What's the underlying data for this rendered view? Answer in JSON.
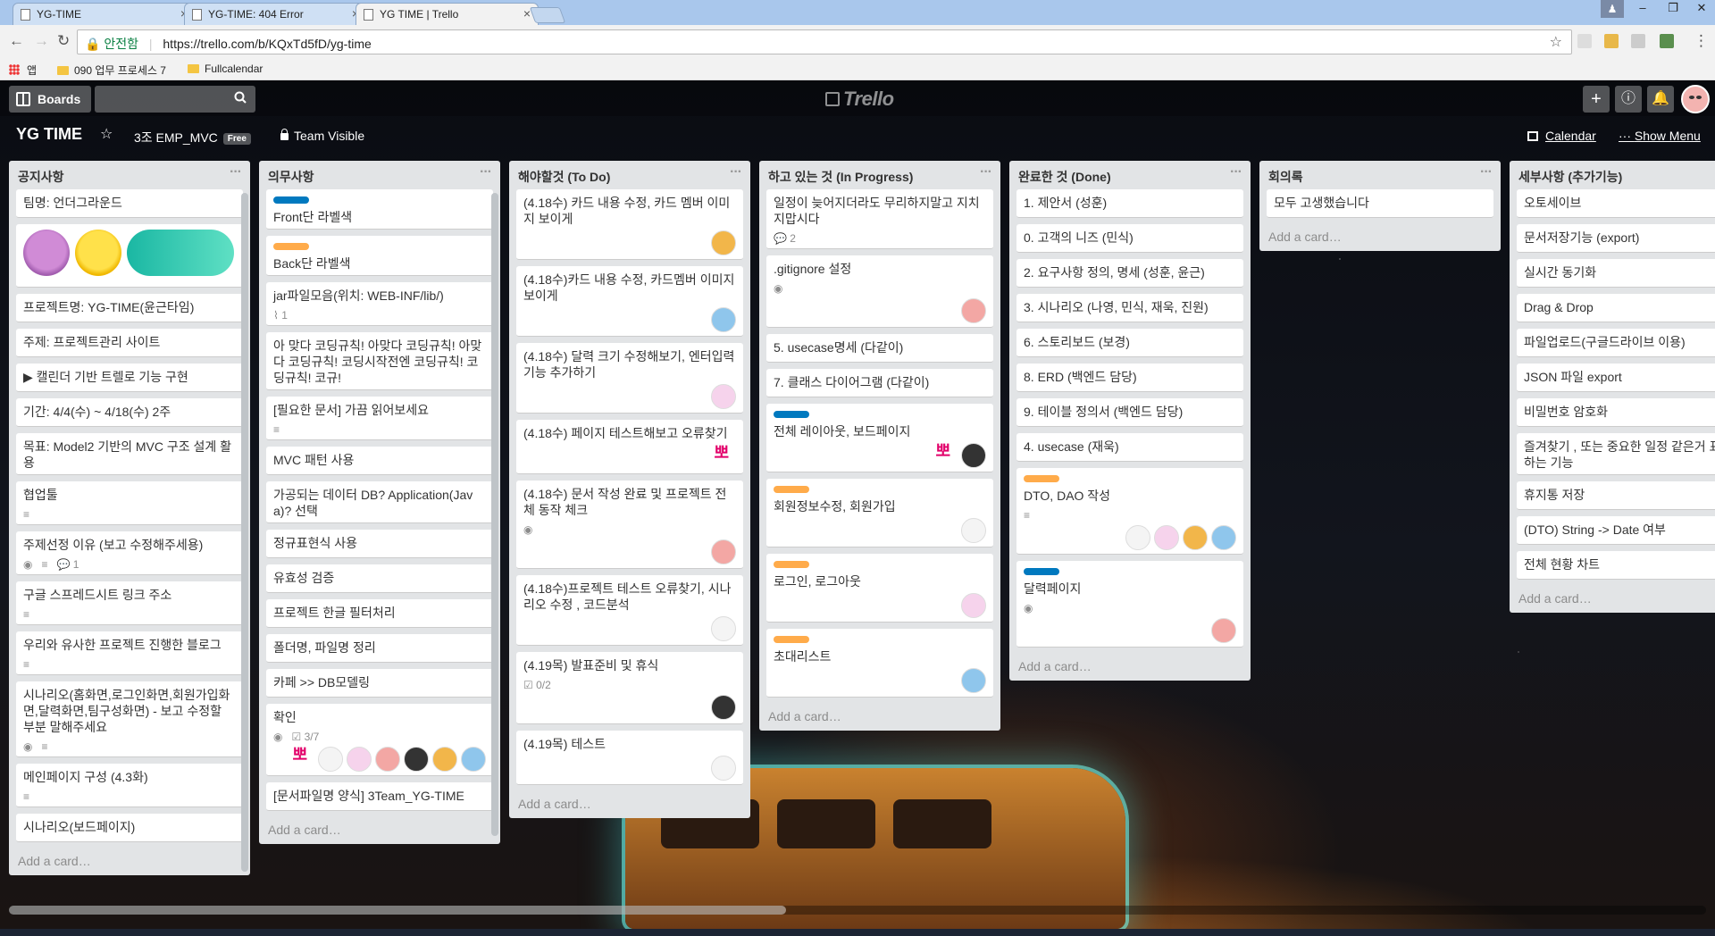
{
  "browser": {
    "tabs": [
      {
        "title": "YG-TIME"
      },
      {
        "title": "YG-TIME: 404 Error"
      },
      {
        "title": "YG TIME | Trello",
        "active": true
      }
    ],
    "secure_label": "안전함",
    "url": "https://trello.com/b/KQxTd5fD/yg-time",
    "bookmarks": [
      "앱",
      "090 업무 프로세스 7",
      "Fullcalendar"
    ]
  },
  "header": {
    "boards_label": "Boards",
    "search_placeholder": "",
    "logo_text": "Trello"
  },
  "board": {
    "title": "YG TIME",
    "team": "3조 EMP_MVC",
    "team_badge": "Free",
    "visibility": "Team Visible",
    "calendar_label": "Calendar",
    "show_menu_label": "Show Menu",
    "add_card_label": "Add a card…"
  },
  "colors": {
    "label_blue": "#0079bf",
    "label_orange": "#ffab4a",
    "pink_sticker": "#e2006a",
    "board_text": "#ffffff"
  },
  "lists": [
    {
      "title": "공지사항",
      "cards": [
        {
          "text": "팀명: 언더그라운드"
        },
        {
          "text": "",
          "emoji": true
        },
        {
          "text": "프로젝트명: YG-TIME(윤근타임)"
        },
        {
          "text": "주제: 프로젝트관리 사이트"
        },
        {
          "text": "▶ 캘린더 기반 트렐로 기능 구현"
        },
        {
          "text": "기간: 4/4(수) ~ 4/18(수) 2주"
        },
        {
          "text": "목표: Model2 기반의 MVC 구조 설계 활용"
        },
        {
          "text": "협업툴",
          "badges": [
            "desc"
          ]
        },
        {
          "text": "주제선정 이유 (보고 수정해주세용)",
          "badges": [
            "watch",
            "desc",
            "comment"
          ],
          "comments": "1"
        },
        {
          "text": "구글 스프레드시트 링크 주소",
          "badges": [
            "desc"
          ]
        },
        {
          "text": "우리와 유사한 프로젝트 진행한 블로그",
          "badges": [
            "desc"
          ]
        },
        {
          "text": "시나리오(홈화면,로그인화면,회원가입화면,달력화면,팀구성화면) - 보고 수정할 부분 말해주세요",
          "badges": [
            "watch",
            "desc"
          ]
        },
        {
          "text": "메인페이지 구성 (4.3화)",
          "badges": [
            "desc"
          ]
        },
        {
          "text": "시나리오(보드페이지)"
        }
      ]
    },
    {
      "title": "의무사항",
      "cards": [
        {
          "text": "Front단 라벨색",
          "label": "blue"
        },
        {
          "text": "Back단 라벨색",
          "label": "orange"
        },
        {
          "text": "jar파일모음(위치: WEB-INF/lib/)",
          "badges": [
            "attach"
          ],
          "attachments": "1"
        },
        {
          "text": "아 맞다 코딩규칙! 아맞다 코딩규칙! 아맞다 코딩규칙! 코딩시작전엔 코딩규칙! 코딩규칙! 코규!"
        },
        {
          "text": "[필요한 문서] 가끔 읽어보세요",
          "badges": [
            "desc"
          ]
        },
        {
          "text": "MVC 패턴 사용"
        },
        {
          "text": "가공되는 데이터 DB? Application(Java)? 선택"
        },
        {
          "text": "정규표현식 사용"
        },
        {
          "text": "유효성 검증"
        },
        {
          "text": "프로젝트 한글 필터처리"
        },
        {
          "text": "폴더명, 파일명 정리"
        },
        {
          "text": "카페 >> DB모델링"
        },
        {
          "text": "확인",
          "badges": [
            "watch",
            "check"
          ],
          "checklist": "3/7",
          "members": [
            "girl",
            "unicorn",
            "pinkface",
            "gorilla",
            "fox",
            "blue"
          ],
          "sticker": "뽀"
        },
        {
          "text": "[문서파일명 양식] 3Team_YG-TIME"
        }
      ]
    },
    {
      "title": "해야할것 (To Do)",
      "cards": [
        {
          "text": "(4.18수) 카드 내용 수정, 카드 멤버 이미지 보이게",
          "members": [
            "fox"
          ]
        },
        {
          "text": "(4.18수)카드 내용 수정, 카드멤버 이미지 보이게",
          "members": [
            "blue"
          ]
        },
        {
          "text": "(4.18수) 달력 크기 수정해보기, 엔터입력 기능 추가하기",
          "members": [
            "unicorn"
          ]
        },
        {
          "text": "(4.18수) 페이지 테스트해보고 오류찾기",
          "sticker": "뽀"
        },
        {
          "text": "(4.18수) 문서 작성 완료 및 프로젝트 전체 동작 체크",
          "badges": [
            "watch"
          ],
          "members": [
            "pinkface"
          ]
        },
        {
          "text": "(4.18수)프로젝트 테스트 오류찾기, 시나리오 수정 , 코드분석",
          "members": [
            "girl"
          ]
        },
        {
          "text": "(4.19목) 발표준비 및 휴식",
          "badges": [
            "check"
          ],
          "checklist": "0/2",
          "members": [
            "gorilla"
          ]
        },
        {
          "text": "(4.19목) 테스트",
          "members": [
            "girl"
          ]
        }
      ]
    },
    {
      "title": "하고 있는 것 (In Progress)",
      "cards": [
        {
          "text": "일정이 늦어지더라도 무리하지말고 지치지맙시다",
          "badges": [
            "comment"
          ],
          "comments": "2"
        },
        {
          "text": ".gitignore 설정",
          "badges": [
            "watch"
          ],
          "members": [
            "pinkface"
          ]
        },
        {
          "text": "5. usecase명세 (다같이)"
        },
        {
          "text": "7. 클래스 다이어그램 (다같이)"
        },
        {
          "text": "전체 레이아웃, 보드페이지",
          "label": "blue",
          "sticker": "뽀",
          "members": [
            "gorilla"
          ]
        },
        {
          "text": "회원정보수정, 회원가입",
          "label": "orange",
          "members": [
            "girl"
          ]
        },
        {
          "text": "로그인, 로그아웃",
          "label": "orange",
          "members": [
            "unicorn"
          ]
        },
        {
          "text": "초대리스트",
          "label": "orange",
          "members": [
            "blue"
          ]
        }
      ]
    },
    {
      "title": "완료한 것 (Done)",
      "cards": [
        {
          "text": "1. 제안서 (성훈)"
        },
        {
          "text": "0. 고객의 니즈 (민식)"
        },
        {
          "text": "2. 요구사항 정의, 명세 (성훈, 윤근)"
        },
        {
          "text": "3. 시나리오 (나영, 민식, 재욱, 진원)"
        },
        {
          "text": "6. 스토리보드 (보경)"
        },
        {
          "text": "8. ERD (백엔드 담당)"
        },
        {
          "text": "9. 테이블 정의서 (백엔드 담당)"
        },
        {
          "text": "4. usecase (재욱)"
        },
        {
          "text": "DTO, DAO 작성",
          "label": "orange",
          "badges": [
            "desc"
          ],
          "members": [
            "girl",
            "unicorn",
            "fox",
            "blue"
          ]
        },
        {
          "text": "달력페이지",
          "label": "blue",
          "badges": [
            "watch"
          ],
          "members": [
            "pinkface"
          ]
        }
      ]
    },
    {
      "title": "회의록",
      "cards": [
        {
          "text": "모두 고생했습니다"
        }
      ]
    },
    {
      "title": "세부사항 (추가기능)",
      "cards": [
        {
          "text": "오토세이브"
        },
        {
          "text": "문서저장기능 (export)"
        },
        {
          "text": "실시간 동기화"
        },
        {
          "text": "Drag & Drop"
        },
        {
          "text": "파일업로드(구글드라이브 이용)"
        },
        {
          "text": "JSON 파일 export"
        },
        {
          "text": "비밀번호 암호화"
        },
        {
          "text": "즐겨찾기 , 또는 중요한 일정 같은거 표시하는 기능"
        },
        {
          "text": "휴지통 저장"
        },
        {
          "text": "(DTO) String -> Date 여부"
        },
        {
          "text": "전체 현황 차트"
        }
      ]
    }
  ]
}
